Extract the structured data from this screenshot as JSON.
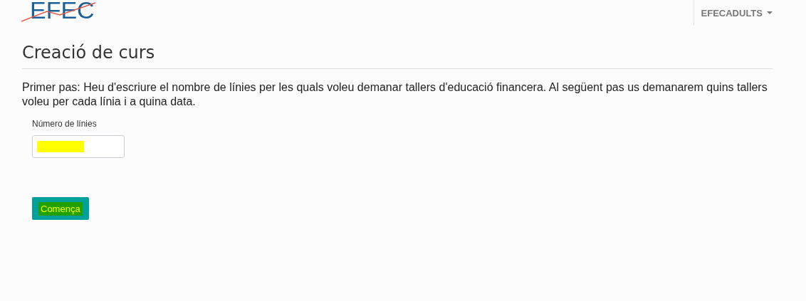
{
  "logo": {
    "text": "EFEC"
  },
  "nav": {
    "user_menu": "EFECADULTS"
  },
  "title": "Creació de curs",
  "intro": "Primer pas: Heu d'escriure el nombre de línies per les quals voleu demanar tallers d'educació financera. Al següent pas us demanarem quins tallers voleu per cada línia i a quina data.",
  "form": {
    "label": "Número de línies",
    "button": "Comença"
  }
}
